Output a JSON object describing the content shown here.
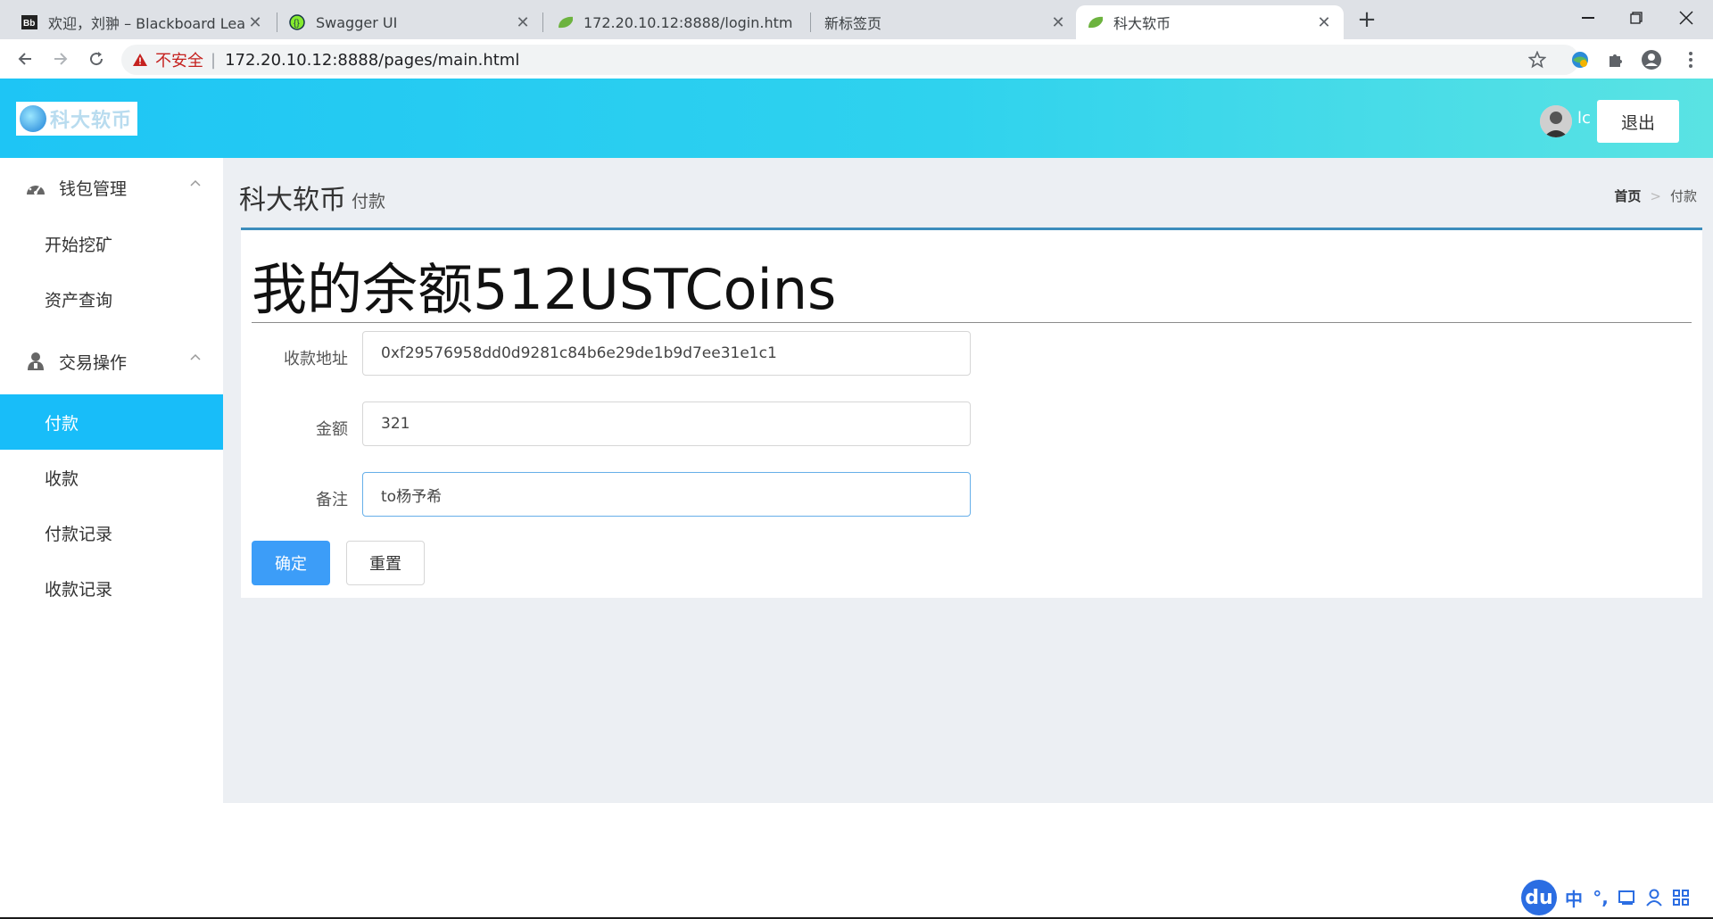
{
  "browser": {
    "tabs": [
      {
        "title": "欢迎，刘翀 – Blackboard Learn",
        "icon": "blackboard-icon"
      },
      {
        "title": "Swagger UI",
        "icon": "swagger-icon"
      },
      {
        "title": "172.20.10.12:8888/login.htm",
        "icon": "leaf-icon"
      },
      {
        "title": "新标签页",
        "icon": ""
      },
      {
        "title": "科大软币",
        "icon": "leaf-icon"
      }
    ],
    "new_tab_label": "+",
    "insecure_label": "不安全",
    "separator": "|",
    "url": "172.20.10.12:8888/pages/main.html"
  },
  "header": {
    "logo_text": "科大软币",
    "user_name": "lc",
    "logout_label": "退出"
  },
  "sidebar": {
    "groups": [
      {
        "label": "钱包管理",
        "icon": "dashboard-icon",
        "items": [
          {
            "label": "开始挖矿"
          },
          {
            "label": "资产查询"
          }
        ]
      },
      {
        "label": "交易操作",
        "icon": "user-icon",
        "items": [
          {
            "label": "付款",
            "active": true
          },
          {
            "label": "收款"
          },
          {
            "label": "付款记录"
          },
          {
            "label": "收款记录"
          }
        ]
      }
    ]
  },
  "main": {
    "title": "科大软币",
    "subtitle": "付款",
    "breadcrumb": {
      "home": "首页",
      "separator": ">",
      "current": "付款"
    },
    "balance_text": "我的余额512USTCoins",
    "form": {
      "address_label": "收款地址",
      "address_value": "0xf29576958dd0d9281c84b6e29de1b9d7ee31e1c1",
      "amount_label": "金额",
      "amount_value": "321",
      "note_label": "备注",
      "note_value": "to杨予希"
    },
    "confirm_label": "确定",
    "reset_label": "重置"
  },
  "ime": {
    "logo": "du",
    "lang": "中",
    "punct": "°,"
  },
  "colors": {
    "header_gradient_start": "#1ec5f5",
    "header_gradient_end": "#5ae3e3",
    "sidebar_active": "#18bdf9",
    "primary_button": "#3c9df8",
    "card_top_border": "#3c8dbc"
  }
}
